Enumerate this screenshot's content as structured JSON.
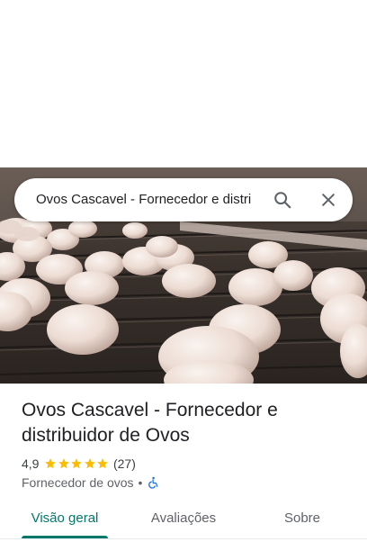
{
  "search": {
    "query": "Ovos Cascavel - Fornecedor e distri",
    "search_icon": "search-icon",
    "close_icon": "close-icon"
  },
  "hero": {
    "description_icon": "photo-eggs-on-conveyor"
  },
  "place": {
    "title": "Ovos Cascavel - Fornecedor e distribuidor de Ovos",
    "rating": "4,9",
    "stars": 5,
    "review_count": "(27)",
    "category": "Fornecedor de ovos",
    "separator": "•",
    "accessibility_icon": "wheelchair-icon"
  },
  "tabs": [
    {
      "label": "Visão geral",
      "active": true
    },
    {
      "label": "Avaliações",
      "active": false
    },
    {
      "label": "Sobre",
      "active": false
    }
  ],
  "colors": {
    "accent": "#00796b",
    "star": "#fbbc04",
    "accessibility": "#1a73e8"
  }
}
